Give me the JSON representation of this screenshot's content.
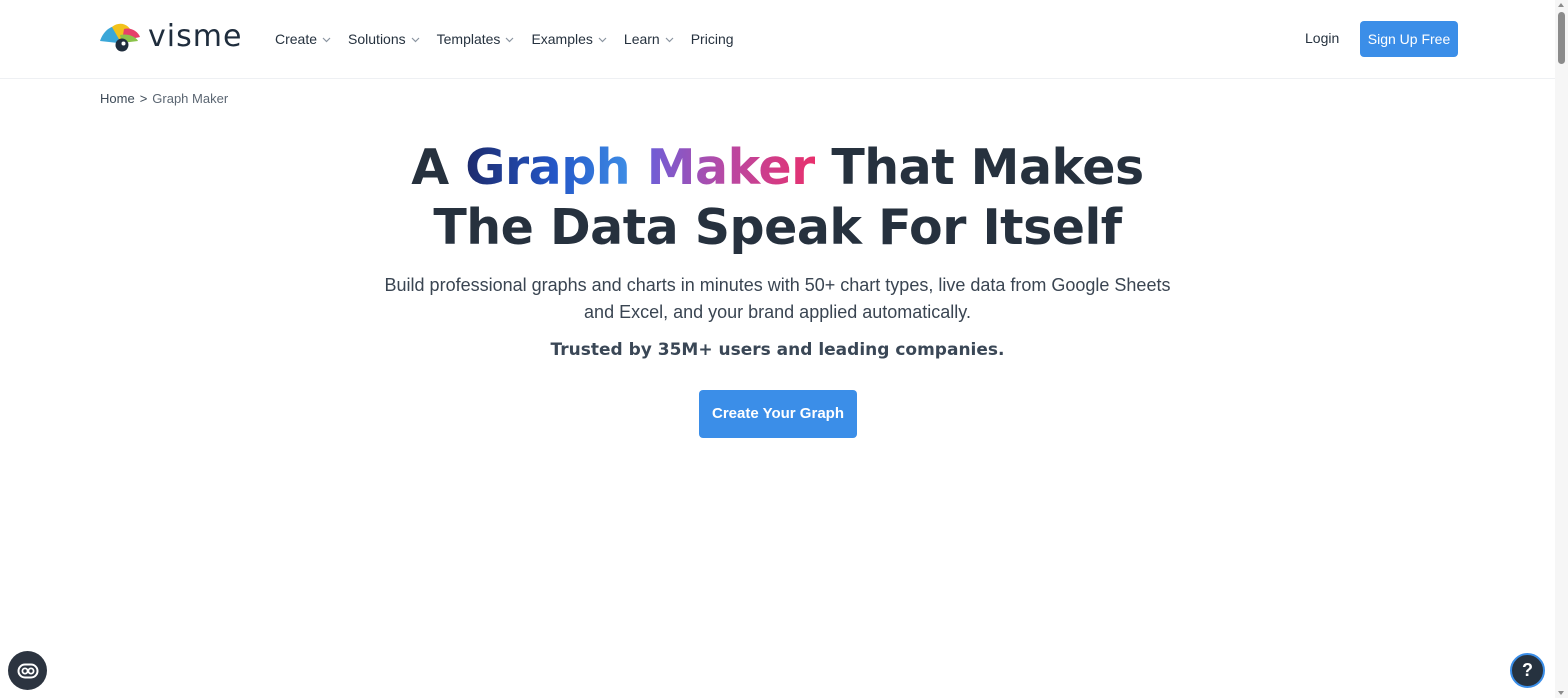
{
  "header": {
    "logo_text": "visme",
    "nav": [
      {
        "label": "Create",
        "has_dropdown": true
      },
      {
        "label": "Solutions",
        "has_dropdown": true
      },
      {
        "label": "Templates",
        "has_dropdown": true
      },
      {
        "label": "Examples",
        "has_dropdown": true
      },
      {
        "label": "Learn",
        "has_dropdown": true
      },
      {
        "label": "Pricing",
        "has_dropdown": false
      }
    ],
    "login_label": "Login",
    "signup_label": "Sign Up Free"
  },
  "breadcrumb": {
    "home": "Home",
    "separator": ">",
    "current": "Graph Maker"
  },
  "hero": {
    "title_part1": "A ",
    "title_highlight1": "Graph",
    "title_space": " ",
    "title_highlight2": "Maker",
    "title_part2": " That Makes",
    "title_line2": "The Data Speak For Itself",
    "subtitle_line1": "Build professional graphs and charts in minutes with 50+ chart types, live data from Google Sheets",
    "subtitle_line2": "and Excel, and your brand applied automatically.",
    "trusted": "Trusted by 35M+ users and leading companies.",
    "cta_label": "Create Your Graph"
  },
  "floating": {
    "help_label": "?",
    "accessibility_icon": "accessibility-icon"
  },
  "colors": {
    "brand_blue": "#3b8ee8",
    "heading": "#26313e",
    "gradient_graph": [
      "#1d2a6b",
      "#3f8ee6"
    ],
    "gradient_maker": [
      "#6d5fd8",
      "#e8306d"
    ]
  }
}
